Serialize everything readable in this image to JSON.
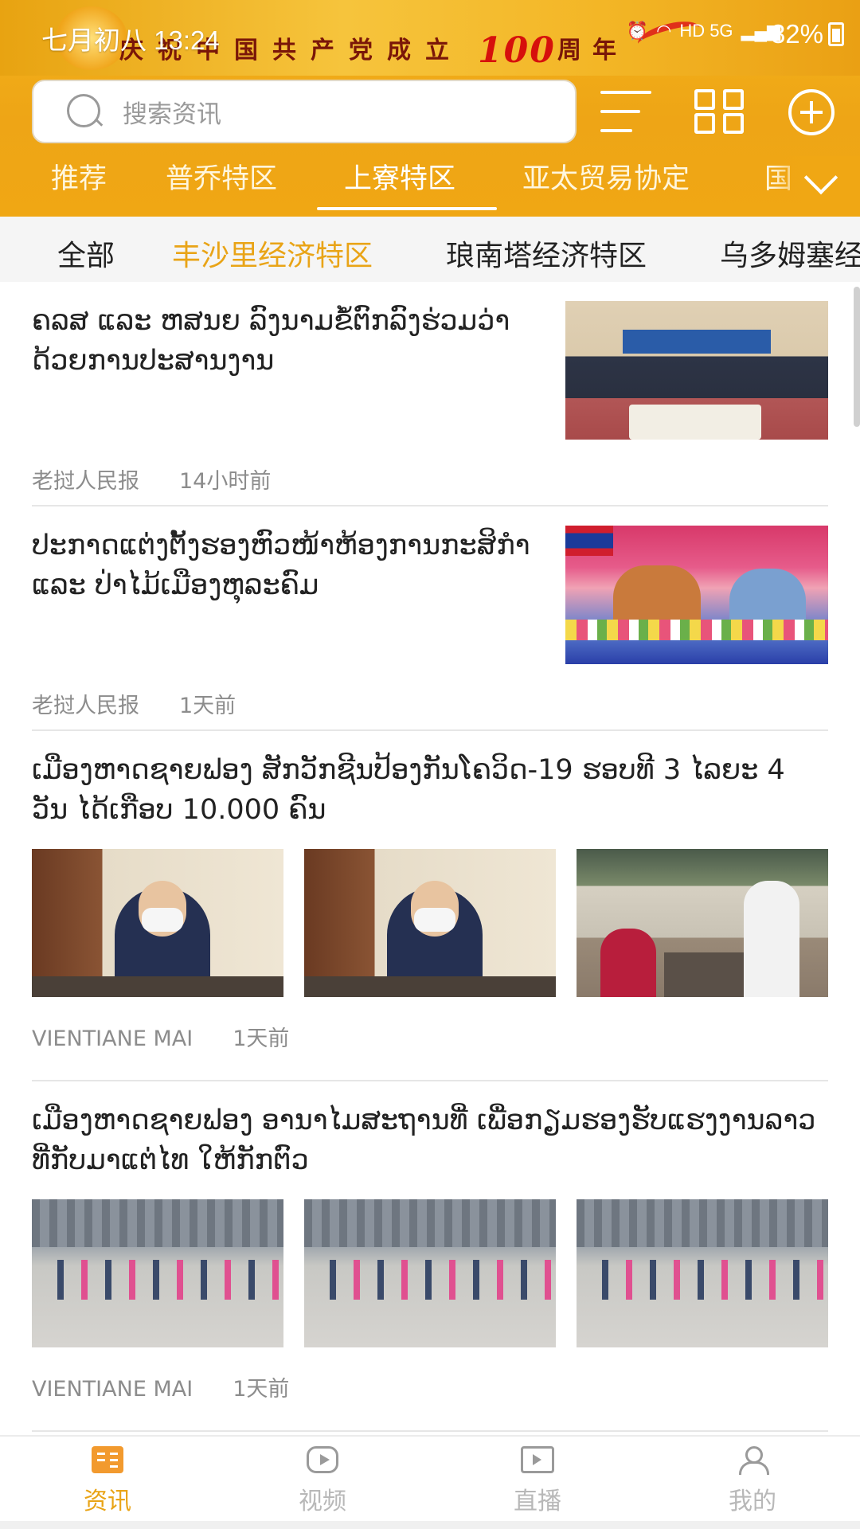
{
  "status_bar": {
    "time": "七月初八 13:24",
    "network": "HD 5G",
    "battery": "82%"
  },
  "banner": {
    "text_left": "庆祝中国共产党成立",
    "number": "100",
    "text_right": "周年"
  },
  "search": {
    "placeholder": "搜索资讯"
  },
  "channel_tabs": [
    {
      "label": "推荐",
      "active": false
    },
    {
      "label": "普乔特区",
      "active": false
    },
    {
      "label": "上寮特区",
      "active": true
    },
    {
      "label": "亚太贸易协定",
      "active": false
    },
    {
      "label": "国",
      "active": false
    }
  ],
  "sub_tabs": [
    {
      "label": "全部",
      "active": false
    },
    {
      "label": "丰沙里经济特区",
      "active": true
    },
    {
      "label": "琅南塔经济特区",
      "active": false
    },
    {
      "label": "乌多姆塞经",
      "active": false
    }
  ],
  "articles": [
    {
      "title": "ຄລສ ແລະ ຫສນຍ ລົງນາມຂໍ້ຕົກລົງຮ່ວມວ່າດ້ວຍການປະສານງານ",
      "source": "老挝人民报",
      "time": "14小时前",
      "layout": "single"
    },
    {
      "title": "ປະກາດແຕ່ງຕັ້ງຮອງຫົວໜ້າຫ້ອງການກະສິກຳ ແລະ ປ່າໄມ້ເມືອງຫຸລະຄົມ",
      "source": "老挝人民报",
      "time": "1天前",
      "layout": "single"
    },
    {
      "title": "ເມືອງຫາດຊາຍຟອງ ສັກວັກຊີນປ້ອງກັນໂຄວິດ-19 ຮອບທີ 3 ໄລຍະ 4 ວັນ ໄດ້ເກືອບ 10.000 ຄົນ",
      "source": "VIENTIANE MAI",
      "time": "1天前",
      "layout": "triple"
    },
    {
      "title": "ເມືອງຫາດຊາຍຟອງ ອານາໄມສະຖານທີ່ ເພື່ອກຽມຮອງຮັບແຮງງານລາວ ທີ່ກັບມາແຕ່ໄທ ໃຫ້ກັກຕົວ",
      "source": "VIENTIANE MAI",
      "time": "1天前",
      "layout": "triple"
    }
  ],
  "bottom_nav": [
    {
      "label": "资讯",
      "icon": "news-icon",
      "active": true
    },
    {
      "label": "视频",
      "icon": "video-icon",
      "active": false
    },
    {
      "label": "直播",
      "icon": "live-icon",
      "active": false
    },
    {
      "label": "我的",
      "icon": "user-icon",
      "active": false
    }
  ],
  "colors": {
    "accent": "#e9a417",
    "header": "#f0a714"
  }
}
